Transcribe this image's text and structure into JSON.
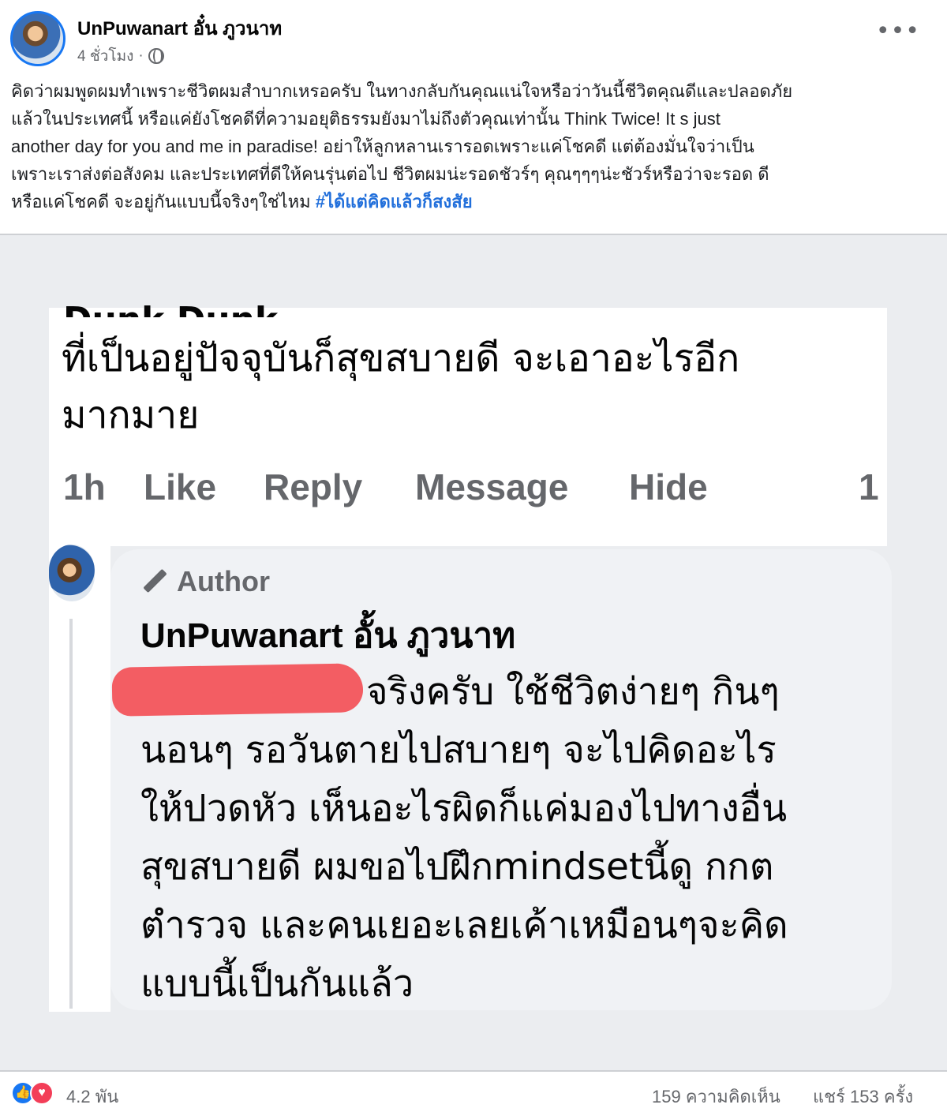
{
  "post": {
    "author": "UnPuwanart อั๋น ภูวนาท",
    "time": "4 ชั่วโมง",
    "privacy_icon": "globe-icon",
    "more_icon": "more-icon",
    "text_lines": [
      "คิดว่าผมพูดผมทำเพราะชีวิตผมสำบากเหรอครับ   ในทางกลับกันคุณแน่ใจหรือว่าวันนี้ชีวิตคุณดีและปลอดภัย",
      "แล้วในประเทศนี้   หรือแค่ยังโชคดีที่ความอยุติธรรมยังมาไม่ถึงตัวคุณเท่านั้น    Think Twice!  It s just",
      "another day for you and me in paradise!   อย่าให้ลูกหลานเรารอดเพราะแค่โชคดี แต่ต้องมั่นใจว่าเป็น",
      "เพราะเราส่งต่อสังคม และประเทศที่ดีให้คนรุ่นต่อไป    ชีวิตผมน่ะรอดชัวร์ๆ คุณๆๆๆน่ะชัวร์หรือว่าจะรอด    ดี",
      "หรือแค่โชคดี จะอยู่กันแบบนี้จริงๆใช่ไหม "
    ],
    "hashtag": "#ได้แต่คิดแล้วก็สงสัย"
  },
  "embedded": {
    "comment1": {
      "cut_name": "Dunk Dunk",
      "line1": "ที่เป็นอยู่ปัจจุบันก็สุขสบายดี จะเอาอะไรอีก",
      "line2": "มากมาย"
    },
    "actions": {
      "time": "1h",
      "like": "Like",
      "reply": "Reply",
      "message": "Message",
      "hide": "Hide",
      "reaction_count": "1"
    },
    "reply": {
      "badge": "Author",
      "badge_icon": "pencil-icon",
      "name": "UnPuwanart อั้น ภูวนาท",
      "lines": [
        "จริงครับ  ใช้ชีวิตง่ายๆ กินๆ",
        "นอนๆ รอวันตายไปสบายๆ   จะไปคิดอะไร",
        "ให้ปวดหัว   เห็นอะไรผิดก็แค่มองไปทางอื่น",
        "สุขสบายดี   ผมขอไปฝึกmindsetนี้ดู   กกต",
        "ตำรวจ และคนเยอะเลยเค้าเหมือนๆจะคิด",
        "แบบนี้เป็นกันแล้ว"
      ]
    }
  },
  "footer": {
    "reactions": "4.2 พัน",
    "comments": "159 ความคิดเห็น",
    "shares": "แชร์ 153 ครั้ง",
    "reaction_icons": [
      "like-icon",
      "love-icon"
    ]
  },
  "colors": {
    "link_blue": "#216fdb",
    "secondary_text": "#65676b",
    "redaction": "#f2545b",
    "comment_bubble": "#f0f2f5",
    "embed_bg": "#ebedf0"
  }
}
